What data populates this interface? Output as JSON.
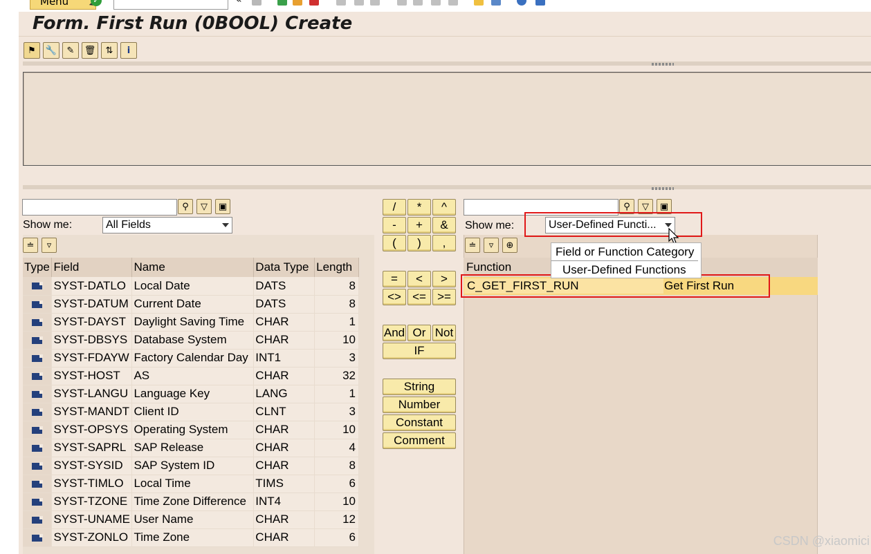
{
  "toolbar": {
    "menu_label": "Menu"
  },
  "title": "Form. First Run (0BOOL) Create",
  "left_panel": {
    "show_me_label": "Show me:",
    "show_me_value": "All Fields",
    "columns": [
      "Type",
      "Field",
      "Name",
      "Data Type",
      "Length"
    ],
    "rows": [
      {
        "field": "SYST-DATLO",
        "name": "Local Date",
        "dtype": "DATS",
        "length": "8"
      },
      {
        "field": "SYST-DATUM",
        "name": "Current Date",
        "dtype": "DATS",
        "length": "8"
      },
      {
        "field": "SYST-DAYST",
        "name": "Daylight Saving Time",
        "dtype": "CHAR",
        "length": "1"
      },
      {
        "field": "SYST-DBSYS",
        "name": "Database System",
        "dtype": "CHAR",
        "length": "10"
      },
      {
        "field": "SYST-FDAYW",
        "name": "Factory Calendar Day",
        "dtype": "INT1",
        "length": "3"
      },
      {
        "field": "SYST-HOST",
        "name": "AS",
        "dtype": "CHAR",
        "length": "32"
      },
      {
        "field": "SYST-LANGU",
        "name": "Language Key",
        "dtype": "LANG",
        "length": "1"
      },
      {
        "field": "SYST-MANDT",
        "name": "Client ID",
        "dtype": "CLNT",
        "length": "3"
      },
      {
        "field": "SYST-OPSYS",
        "name": "Operating System",
        "dtype": "CHAR",
        "length": "10"
      },
      {
        "field": "SYST-SAPRL",
        "name": "SAP Release",
        "dtype": "CHAR",
        "length": "4"
      },
      {
        "field": "SYST-SYSID",
        "name": "SAP System ID",
        "dtype": "CHAR",
        "length": "8"
      },
      {
        "field": "SYST-TIMLO",
        "name": "Local Time",
        "dtype": "TIMS",
        "length": "6"
      },
      {
        "field": "SYST-TZONE",
        "name": "Time Zone Difference",
        "dtype": "INT4",
        "length": "10"
      },
      {
        "field": "SYST-UNAME",
        "name": "User Name",
        "dtype": "CHAR",
        "length": "12"
      },
      {
        "field": "SYST-ZONLO",
        "name": "Time Zone",
        "dtype": "CHAR",
        "length": "6"
      }
    ]
  },
  "operators": {
    "row1": [
      "/",
      "*",
      "^"
    ],
    "row2": [
      "-",
      "+",
      "&"
    ],
    "row3": [
      "(",
      ")",
      ","
    ],
    "row4": [
      "=",
      "<",
      ">"
    ],
    "row5": [
      "<>",
      "<=",
      ">="
    ],
    "logic": [
      "And",
      "Or",
      "Not"
    ],
    "if_label": "IF",
    "string_label": "String",
    "number_label": "Number",
    "constant_label": "Constant",
    "comment_label": "Comment"
  },
  "right_panel": {
    "show_me_label": "Show me:",
    "show_me_value": "User-Defined Functi...",
    "column": "Function",
    "dropdown_options": [
      "Field or Function Category",
      "User-Defined Functions"
    ],
    "selected_function": "C_GET_FIRST_RUN",
    "selected_description": "Get First Run"
  },
  "watermark": "CSDN @xiaomici"
}
